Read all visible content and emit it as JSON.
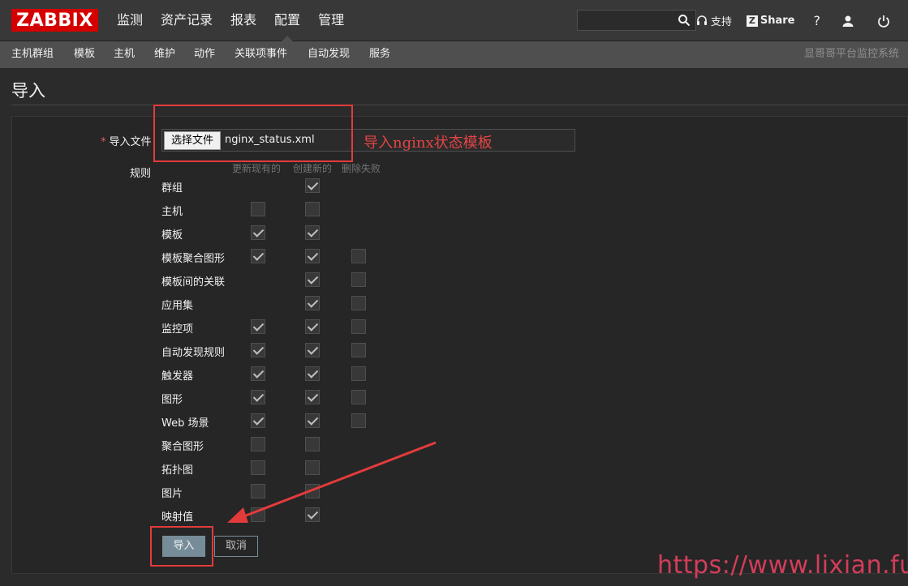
{
  "header": {
    "logo": "ZABBIX",
    "menu": [
      "监测",
      "资产记录",
      "报表",
      "配置",
      "管理"
    ],
    "active_menu_index": 3,
    "search_placeholder": "",
    "support_label": "支持",
    "share_label": "Share",
    "help_label": "?"
  },
  "submenu": {
    "items": [
      "主机群组",
      "模板",
      "主机",
      "维护",
      "动作",
      "关联项事件",
      "自动发现",
      "服务"
    ],
    "server_name": "显哥哥平台监控系统"
  },
  "page": {
    "title": "导入"
  },
  "form": {
    "file_label": "导入文件",
    "file_button": "选择文件",
    "file_name": "nginx_status.xml",
    "rules_label": "规则",
    "columns": [
      "更新现有的",
      "创建新的",
      "删除失败"
    ],
    "rules": [
      {
        "name": "群组",
        "update": null,
        "create": true,
        "delete": null
      },
      {
        "name": "主机",
        "update": false,
        "create": false,
        "delete": null
      },
      {
        "name": "模板",
        "update": true,
        "create": true,
        "delete": null
      },
      {
        "name": "模板聚合图形",
        "update": true,
        "create": true,
        "delete": false
      },
      {
        "name": "模板间的关联",
        "update": null,
        "create": true,
        "delete": false
      },
      {
        "name": "应用集",
        "update": null,
        "create": true,
        "delete": false
      },
      {
        "name": "监控项",
        "update": true,
        "create": true,
        "delete": false
      },
      {
        "name": "自动发现规则",
        "update": true,
        "create": true,
        "delete": false
      },
      {
        "name": "触发器",
        "update": true,
        "create": true,
        "delete": false
      },
      {
        "name": "图形",
        "update": true,
        "create": true,
        "delete": false
      },
      {
        "name": "Web 场景",
        "update": true,
        "create": true,
        "delete": false
      },
      {
        "name": "聚合图形",
        "update": false,
        "create": false,
        "delete": null
      },
      {
        "name": "拓扑图",
        "update": false,
        "create": false,
        "delete": null
      },
      {
        "name": "图片",
        "update": false,
        "create": false,
        "delete": null
      },
      {
        "name": "映射值",
        "update": false,
        "create": true,
        "delete": null
      }
    ],
    "import_button": "导入",
    "cancel_button": "取消"
  },
  "annotation": {
    "text": "导入nginx状态模板",
    "color": "#e33b3b"
  },
  "watermark": "https://www.lixian.fun"
}
